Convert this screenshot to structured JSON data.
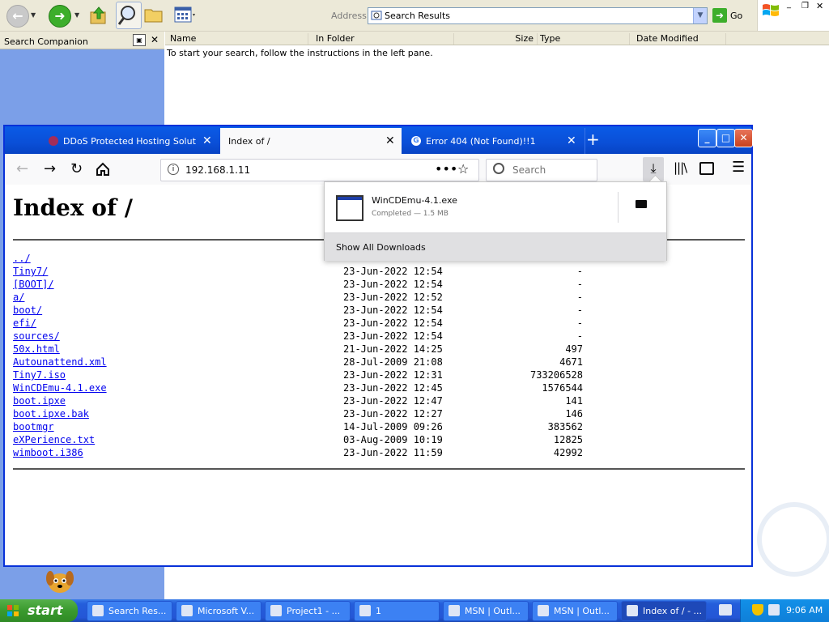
{
  "explorer": {
    "address_label": "Address",
    "address_value": "Search Results",
    "go_label": "Go",
    "companion_title": "Search Companion",
    "columns": [
      "Name",
      "In Folder",
      "Size",
      "Type",
      "Date Modified"
    ],
    "instructions": "To start your search, follow the instructions in the left pane."
  },
  "firefox": {
    "tabs": [
      {
        "label": "DDoS Protected Hosting Solutions",
        "active": false
      },
      {
        "label": "Index of /",
        "active": true
      },
      {
        "label": "Error 404 (Not Found)!!1",
        "active": false
      }
    ],
    "url": "192.168.1.11",
    "search_placeholder": "Search",
    "page": {
      "heading": "Index of /",
      "entries": [
        {
          "name": "../",
          "date": "",
          "size": ""
        },
        {
          "name": "Tiny7/",
          "date": "23-Jun-2022 12:54",
          "size": "-"
        },
        {
          "name": "[BOOT]/",
          "date": "23-Jun-2022 12:54",
          "size": "-"
        },
        {
          "name": "a/",
          "date": "23-Jun-2022 12:52",
          "size": "-"
        },
        {
          "name": "boot/",
          "date": "23-Jun-2022 12:54",
          "size": "-"
        },
        {
          "name": "efi/",
          "date": "23-Jun-2022 12:54",
          "size": "-"
        },
        {
          "name": "sources/",
          "date": "23-Jun-2022 12:54",
          "size": "-"
        },
        {
          "name": "50x.html",
          "date": "21-Jun-2022 14:25",
          "size": "497"
        },
        {
          "name": "Autounattend.xml",
          "date": "28-Jul-2009 21:08",
          "size": "4671"
        },
        {
          "name": "Tiny7.iso",
          "date": "23-Jun-2022 12:31",
          "size": "733206528"
        },
        {
          "name": "WinCDEmu-4.1.exe",
          "date": "23-Jun-2022 12:45",
          "size": "1576544"
        },
        {
          "name": "boot.ipxe",
          "date": "23-Jun-2022 12:47",
          "size": "141"
        },
        {
          "name": "boot.ipxe.bak",
          "date": "23-Jun-2022 12:27",
          "size": "146"
        },
        {
          "name": "bootmgr",
          "date": "14-Jul-2009 09:26",
          "size": "383562"
        },
        {
          "name": "eXPerience.txt",
          "date": "03-Aug-2009 10:19",
          "size": "12825"
        },
        {
          "name": "wimboot.i386",
          "date": "23-Jun-2022 11:59",
          "size": "42992"
        }
      ]
    },
    "downloads": {
      "file_name": "WinCDEmu-4.1.exe",
      "status": "Completed — 1.5 MB",
      "show_all": "Show All Downloads"
    }
  },
  "taskbar": {
    "start_label": "start",
    "tasks": [
      {
        "label": "Search Res...",
        "active": false
      },
      {
        "label": "Microsoft V...",
        "active": false
      },
      {
        "label": "Project1 - ...",
        "active": false
      },
      {
        "label": "1",
        "active": false
      },
      {
        "label": "MSN | Outl...",
        "active": false
      },
      {
        "label": "MSN | Outl...",
        "active": false
      },
      {
        "label": "Index of / - ...",
        "active": true
      }
    ],
    "clock": "9:06 AM"
  },
  "colors": {
    "xp_blue": "#245edb",
    "start_green": "#3a9a2e",
    "link_blue": "#0000ee",
    "companion_blue": "#7b9fe8"
  }
}
